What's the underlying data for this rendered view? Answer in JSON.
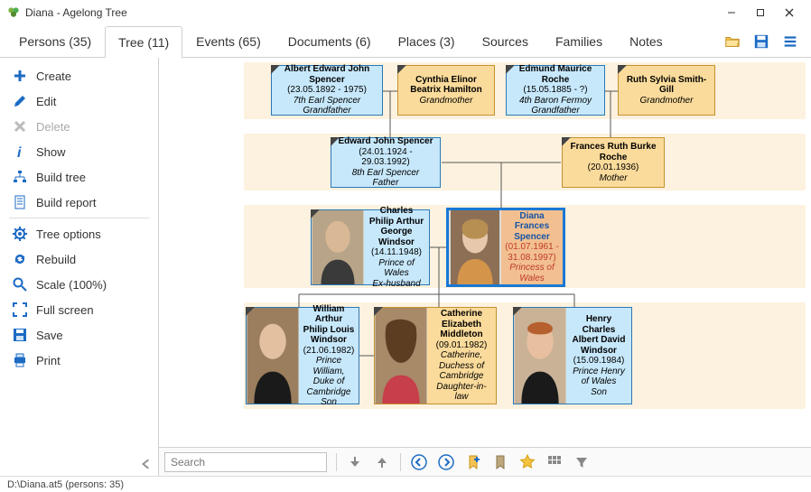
{
  "window": {
    "title": "Diana - Agelong Tree"
  },
  "tabs": [
    {
      "label": "Persons (35)"
    },
    {
      "label": "Tree (11)"
    },
    {
      "label": "Events (65)"
    },
    {
      "label": "Documents (6)"
    },
    {
      "label": "Places (3)"
    },
    {
      "label": "Sources"
    },
    {
      "label": "Families"
    },
    {
      "label": "Notes"
    }
  ],
  "sidebar": {
    "create": "Create",
    "edit": "Edit",
    "delete": "Delete",
    "show": "Show",
    "build_tree": "Build tree",
    "build_report": "Build report",
    "tree_options": "Tree options",
    "rebuild": "Rebuild",
    "scale": "Scale (100%)",
    "full_screen": "Full screen",
    "save": "Save",
    "print": "Print"
  },
  "search": {
    "placeholder": "Search"
  },
  "statusbar": {
    "text": "D:\\Diana.at5 (persons: 35)"
  },
  "people": {
    "g1a": {
      "name": "Albert Edward John Spencer",
      "dates": "(23.05.1892 - 1975)",
      "role1": "7th Earl Spencer",
      "role2": "Grandfather"
    },
    "g1b": {
      "name": "Cynthia Elinor Beatrix Hamilton",
      "role2": "Grandmother"
    },
    "g1c": {
      "name": "Edmund Maurice Roche",
      "dates": "(15.05.1885 - ?)",
      "role1": "4th Baron Fermoy",
      "role2": "Grandfather"
    },
    "g1d": {
      "name": "Ruth Sylvia Smith-Gill",
      "role2": "Grandmother"
    },
    "g2a": {
      "name": "Edward John Spencer",
      "dates": "(24.01.1924 - 29.03.1992)",
      "role1": "8th Earl Spencer",
      "role2": "Father"
    },
    "g2b": {
      "name": "Frances Ruth Burke Roche",
      "dates": "(20.01.1936)",
      "role2": "Mother"
    },
    "g3a": {
      "name": "Charles Philip Arthur George Windsor",
      "dates": "(14.11.1948)",
      "role1": "Prince of Wales",
      "role2": "Ex-husband"
    },
    "g3b": {
      "name": "Diana Frances Spencer",
      "dates": "(01.07.1961 - 31.08.1997)",
      "role1": "Princess of Wales"
    },
    "g4a": {
      "name": "William Arthur Philip Louis Windsor",
      "dates": "(21.06.1982)",
      "role1": "Prince William, Duke of Cambridge",
      "role2": "Son"
    },
    "g4b": {
      "name": "Catherine Elizabeth Middleton",
      "dates": "(09.01.1982)",
      "role1": "Catherine, Duchess of Cambridge",
      "role2": "Daughter-in-law"
    },
    "g4c": {
      "name": "Henry Charles Albert David Windsor",
      "dates": "(15.09.1984)",
      "role1": "Prince Henry of Wales",
      "role2": "Son"
    }
  }
}
